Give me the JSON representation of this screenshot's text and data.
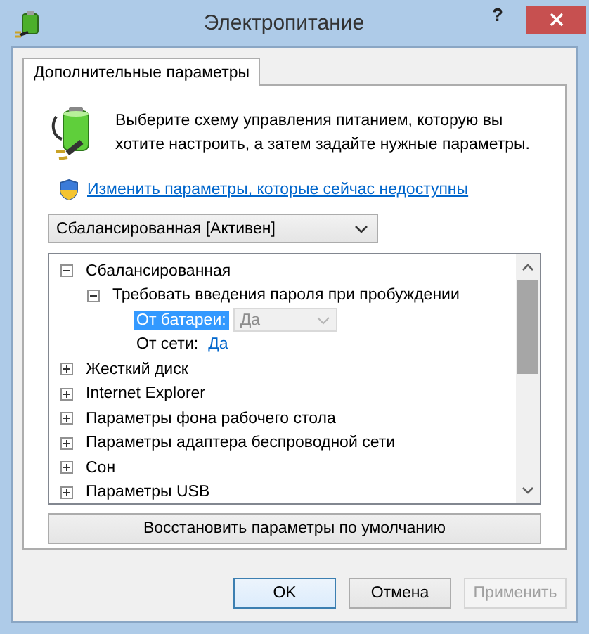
{
  "window": {
    "title": "Электропитание",
    "help_button": "?"
  },
  "tabs": [
    {
      "label": "Дополнительные параметры",
      "selected": true
    }
  ],
  "intro": "Выберите схему управления питанием, которую вы хотите настроить, а затем задайте нужные параметры.",
  "admin_link": "Изменить параметры, которые сейчас недоступны",
  "plan_dropdown": {
    "value": "Сбалансированная [Активен]"
  },
  "tree": {
    "items": [
      {
        "label": "Сбалансированная",
        "expanded": true,
        "children": [
          {
            "label": "Требовать введения пароля при пробуждении",
            "expanded": true,
            "settings": [
              {
                "label": "От батареи:",
                "selected": true,
                "kind": "dropdown",
                "value": "Да",
                "disabled": true
              },
              {
                "label": "От сети:",
                "selected": false,
                "kind": "link",
                "value": "Да",
                "disabled": false
              }
            ]
          }
        ]
      },
      {
        "label": "Жесткий диск",
        "expanded": false
      },
      {
        "label": "Internet Explorer",
        "expanded": false
      },
      {
        "label": "Параметры фона рабочего стола",
        "expanded": false
      },
      {
        "label": "Параметры адаптера беспроводной сети",
        "expanded": false
      },
      {
        "label": "Сон",
        "expanded": false
      },
      {
        "label": "Параметры USB",
        "expanded": false
      }
    ]
  },
  "restore_button": "Восстановить параметры по умолчанию",
  "buttons": [
    {
      "label": "OK",
      "default": true,
      "disabled": false
    },
    {
      "label": "Отмена",
      "default": false,
      "disabled": false
    },
    {
      "label": "Применить",
      "default": false,
      "disabled": true
    }
  ]
}
